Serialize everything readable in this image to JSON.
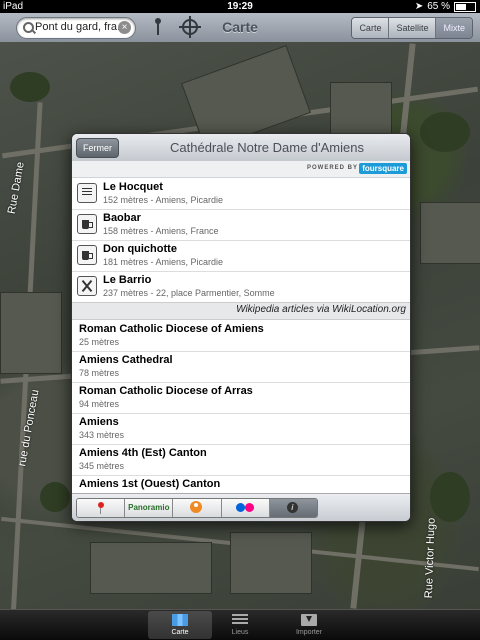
{
  "status_bar": {
    "device": "iPad",
    "time": "19:29",
    "battery": "65 %",
    "battery_level": 0.65
  },
  "toolbar": {
    "search_value": "Pont du gard, fra...",
    "title": "Carte",
    "map_types": [
      "Carte",
      "Satellite",
      "Mixte"
    ],
    "active_map_type": "Mixte"
  },
  "map": {
    "street_labels": [
      "Rue Dame",
      "rue du Ponceau",
      "Rue Victor Hugo"
    ]
  },
  "popover": {
    "close_label": "Fermer",
    "title": "Cathédrale Notre Dame d'Amiens",
    "powered_by": "POWERED BY",
    "provider": "foursquare",
    "venues": [
      {
        "name": "Le Hocquet",
        "detail": "152 mètres - Amiens, Picardie",
        "icon": "list-icon"
      },
      {
        "name": "Baobar",
        "detail": "158 mètres - Amiens, France",
        "icon": "beer-mug-icon"
      },
      {
        "name": "Don quichotte",
        "detail": "181 mètres - Amiens, Picardie",
        "icon": "beer-mug-icon"
      },
      {
        "name": "Le Barrio",
        "detail": "237 mètres - 22, place Parmentier, Somme",
        "icon": "cutlery-icon"
      }
    ],
    "wiki_credit": "Wikipedia articles via WikiLocation.org",
    "articles": [
      {
        "name": "Roman Catholic Diocese of Amiens",
        "distance": "25 mètres"
      },
      {
        "name": "Amiens Cathedral",
        "distance": "78 mètres"
      },
      {
        "name": "Roman Catholic Diocese of Arras",
        "distance": "94 mètres"
      },
      {
        "name": "Amiens",
        "distance": "343 mètres"
      },
      {
        "name": "Amiens 4th (Est) Canton",
        "distance": "345 mètres"
      },
      {
        "name": "Amiens 1st (Ouest) Canton",
        "distance": ""
      }
    ],
    "sources": [
      {
        "name": "pin",
        "icon": "map-pin-icon"
      },
      {
        "name": "Panoramio",
        "label": "Panoramio",
        "icon": "panoramio-icon"
      },
      {
        "name": "person",
        "icon": "person-icon"
      },
      {
        "name": "flickr",
        "icon": "flickr-icon"
      },
      {
        "name": "info",
        "icon": "info-icon",
        "active": true
      }
    ]
  },
  "tab_bar": {
    "tabs": [
      {
        "label": "Carte",
        "active": true
      },
      {
        "label": "Lieus",
        "active": false
      },
      {
        "label": "Importer",
        "active": false
      }
    ]
  }
}
